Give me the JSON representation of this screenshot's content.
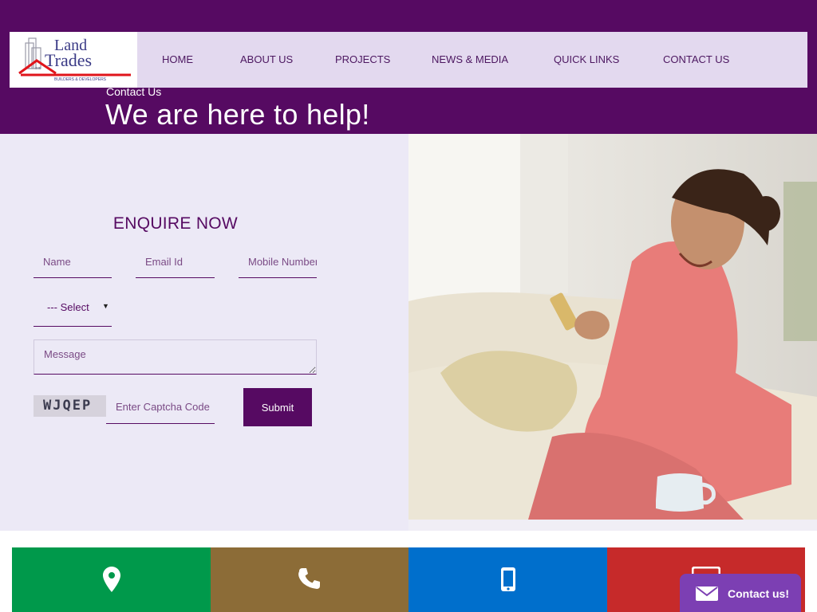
{
  "brand": {
    "logo_line1": "Land",
    "logo_line2": "Trades",
    "logo_tagline": "BUILDERS & DEVELOPERS"
  },
  "nav": {
    "items": [
      {
        "label": "HOME"
      },
      {
        "label": "ABOUT US"
      },
      {
        "label": "PROJECTS"
      },
      {
        "label": "NEWS & MEDIA"
      },
      {
        "label": "QUICK LINKS"
      },
      {
        "label": "CONTACT US"
      }
    ]
  },
  "hero": {
    "breadcrumb": "Contact Us",
    "heading": "We are here to help!"
  },
  "form": {
    "title": "ENQUIRE NOW",
    "name_placeholder": "Name",
    "email_placeholder": "Email Id",
    "mobile_placeholder": "Mobile Number",
    "select_value": "--- Select",
    "message_placeholder": "Message",
    "captcha_text": "WJQEP",
    "captcha_placeholder": "Enter Captcha Code",
    "submit_label": "Submit"
  },
  "tiles": [
    {
      "icon": "location-pin-icon",
      "color": "#00994b"
    },
    {
      "icon": "phone-icon",
      "color": "#8c6c37"
    },
    {
      "icon": "mobile-icon",
      "color": "#006fcc"
    },
    {
      "icon": "envelope-icon",
      "color": "#c62a2a"
    }
  ],
  "contact_chip": {
    "label": "Contact us!",
    "icon": "envelope-icon"
  },
  "colors": {
    "primary": "#560a62",
    "nav_bg": "#e3d9ef",
    "form_bg": "#ece9f6",
    "chip": "#7c3fb3"
  }
}
